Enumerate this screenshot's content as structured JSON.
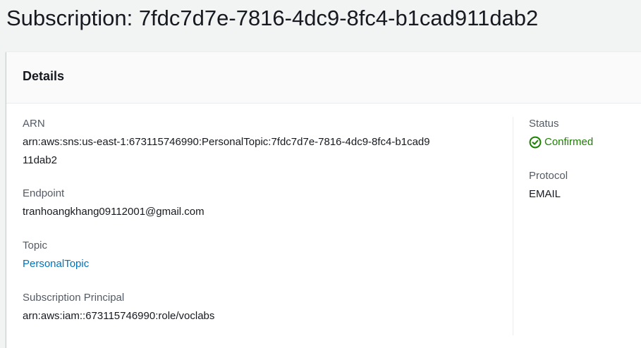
{
  "page": {
    "title": "Subscription: 7fdc7d7e-7816-4dc9-8fc4-b1cad911dab2"
  },
  "details": {
    "header": "Details",
    "arn": {
      "label": "ARN",
      "value": "arn:aws:sns:us-east-1:673115746990:PersonalTopic:7fdc7d7e-7816-4dc9-8fc4-b1cad911dab2"
    },
    "endpoint": {
      "label": "Endpoint",
      "value": "tranhoangkhang09112001@gmail.com"
    },
    "topic": {
      "label": "Topic",
      "value": "PersonalTopic"
    },
    "subscription_principal": {
      "label": "Subscription Principal",
      "value": "arn:aws:iam::673115746990:role/voclabs"
    },
    "status": {
      "label": "Status",
      "value": "Confirmed",
      "icon": "check-circle-icon",
      "color": "#1d8102"
    },
    "protocol": {
      "label": "Protocol",
      "value": "EMAIL"
    }
  },
  "colors": {
    "link": "#0073bb",
    "label": "#545b64",
    "text": "#16191f",
    "background": "#f2f3f3"
  }
}
